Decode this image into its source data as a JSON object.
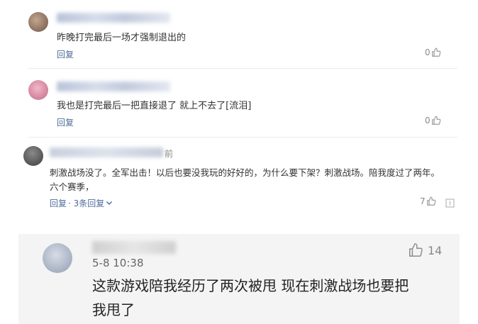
{
  "comments": [
    {
      "text": "昨晚打完最后一场才强制退出的",
      "reply_label": "回复",
      "likes": "0"
    },
    {
      "text": "我也是打完最后一把直接退了 就上不去了[流泪]",
      "reply_label": "回复",
      "likes": "0"
    },
    {
      "time_suffix": "前",
      "text_line1": "刺激战场没了。全军出击！以后也要没我玩的好好的，为什么要下架？刺激战场。陪我度过了两年。",
      "text_line2": "六个赛季，",
      "reply_label": "回复",
      "reply_count_label": "· 3条回复",
      "likes": "7"
    }
  ],
  "featured": {
    "date": "5-8 10:38",
    "likes": "14",
    "text_line1": "这款游戏陪我经历了两次被甩 现在刺激战场也要把",
    "text_line2": "我甩了"
  },
  "colors": {
    "link": "#4f6c9a",
    "muted": "#8a8a8a",
    "card_bg": "#f4f4f4"
  },
  "icons": [
    "thumbs-up-icon",
    "chevron-down-icon",
    "report-icon"
  ]
}
